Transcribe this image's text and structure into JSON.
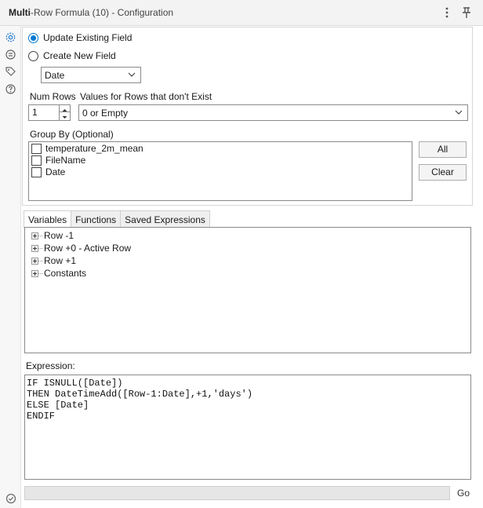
{
  "window": {
    "title_bold": "Multi",
    "title_rest": "-Row Formula (10) - Configuration",
    "menu_icon": "more-vertical-icon",
    "pin_icon": "pin-icon"
  },
  "side_rail": {
    "icons": [
      "gear-icon",
      "connections-icon",
      "tag-icon",
      "help-icon"
    ],
    "status_icon": "check-circle-icon"
  },
  "mode": {
    "options": [
      {
        "label": "Update Existing Field",
        "selected": true
      },
      {
        "label": "Create New  Field",
        "selected": false
      }
    ],
    "field_select": "Date"
  },
  "num_rows": {
    "label": "Num Rows",
    "value": "1"
  },
  "missing_rows": {
    "label": "Values for Rows that don't Exist",
    "value": "0 or Empty"
  },
  "group_by": {
    "label": "Group By (Optional)",
    "items": [
      {
        "label": "temperature_2m_mean",
        "checked": false
      },
      {
        "label": "FileName",
        "checked": false
      },
      {
        "label": "Date",
        "checked": false
      }
    ],
    "all_button": "All",
    "clear_button": "Clear"
  },
  "tabs": [
    {
      "label": "Variables",
      "active": true
    },
    {
      "label": "Functions",
      "active": false
    },
    {
      "label": "Saved Expressions",
      "active": false
    }
  ],
  "tree": [
    "Row -1",
    "Row +0 - Active Row",
    "Row +1",
    "Constants"
  ],
  "expression": {
    "label": "Expression:",
    "lines": [
      "IF ISNULL([Date])",
      "THEN DateTimeAdd([Row-1:Date],+1,'days')",
      "ELSE [Date]",
      "ENDIF"
    ]
  },
  "go_label": "Go",
  "colors": {
    "accent": "#0078d4"
  }
}
